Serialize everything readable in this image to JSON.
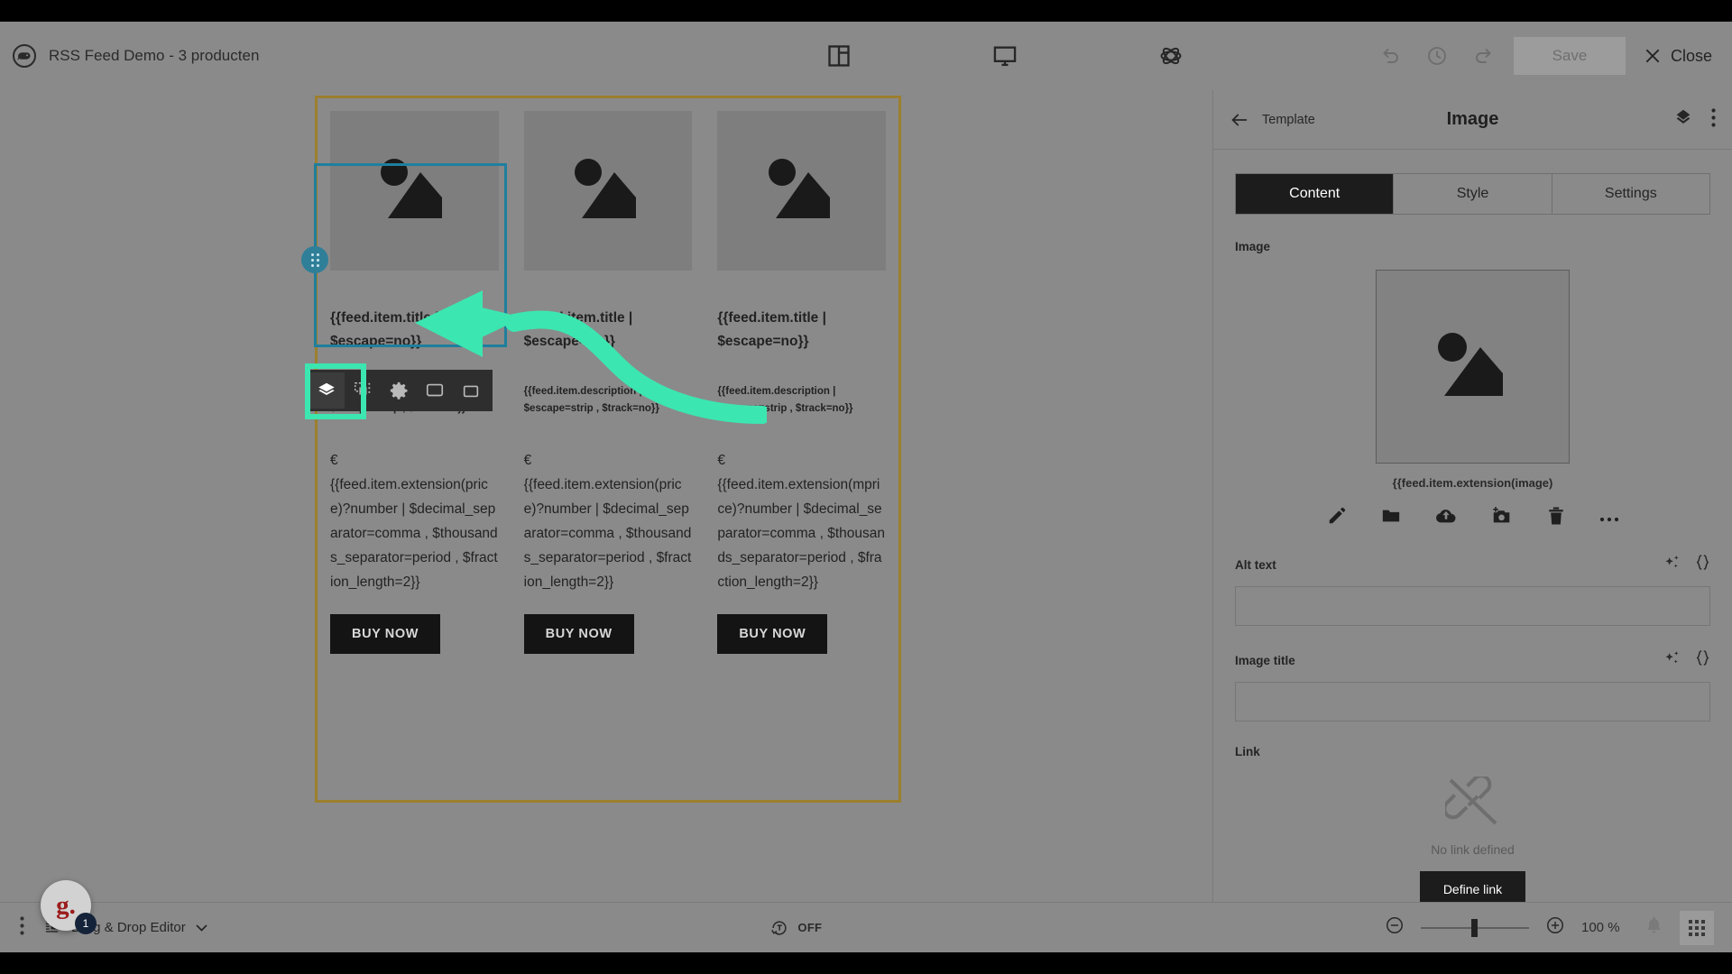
{
  "topbar": {
    "logo_icon": "bird-logo-icon",
    "document_title": "RSS Feed Demo - 3 producten",
    "center_icons": [
      {
        "name": "layout-columns-icon",
        "label": "Layout"
      },
      {
        "name": "desktop-preview-icon",
        "label": "Preview"
      },
      {
        "name": "atom-settings-icon",
        "label": "Settings"
      }
    ],
    "undo_icon": "undo-icon",
    "history_icon": "history-clock-icon",
    "redo_icon": "redo-icon",
    "save_label": "Save",
    "close_label": "Close",
    "close_icon": "close-x-icon"
  },
  "canvas": {
    "element_toolbar": [
      {
        "name": "layers-icon",
        "active": true
      },
      {
        "name": "duplicate-icon",
        "active": false
      },
      {
        "name": "gear-icon",
        "active": false
      },
      {
        "name": "swap-icon",
        "active": false
      },
      {
        "name": "delete-icon",
        "active": false
      }
    ],
    "columns": [
      {
        "title": "{{feed.item.title | $escape=no}}",
        "description": "{{feed.item.description | $escape=strip , $track=no}}",
        "currency": "€",
        "price": "{{feed.item.extension(price)?number | $decimal_separator=comma , $thousands_separator=period , $fraction_length=2}}",
        "button_label": "BUY NOW"
      },
      {
        "title": "{{feed.item.title | $escape=no}}",
        "description": "{{feed.item.description | $escape=strip , $track=no}}",
        "currency": "€",
        "price": "{{feed.item.extension(price)?number | $decimal_separator=comma , $thousands_separator=period , $fraction_length=2}}",
        "button_label": "BUY NOW"
      },
      {
        "title": "{{feed.item.title | $escape=no}}",
        "description": "{{feed.item.description | $escape=strip , $track=no}}",
        "currency": "€",
        "price": "{{feed.item.extension(mprice)?number | $decimal_separator=comma , $thousands_separator=period , $fraction_length=2}}",
        "button_label": "BUY NOW"
      }
    ]
  },
  "right_panel": {
    "back_label": "Template",
    "back_icon": "arrow-left-icon",
    "title": "Image",
    "layers_icon": "layers-diamond-icon",
    "more_icon": "more-vertical-icon",
    "tabs": [
      {
        "label": "Content",
        "active": true
      },
      {
        "label": "Style",
        "active": false
      },
      {
        "label": "Settings",
        "active": false
      }
    ],
    "image_section_label": "Image",
    "image_caption": "{{feed.item.extension(image)",
    "image_actions": [
      {
        "name": "edit-pencil-icon"
      },
      {
        "name": "folder-icon"
      },
      {
        "name": "cloud-upload-icon"
      },
      {
        "name": "camera-add-icon"
      },
      {
        "name": "trash-icon"
      },
      {
        "name": "more-horizontal-icon"
      }
    ],
    "alt_text_label": "Alt text",
    "alt_text_value": "",
    "alt_text_placeholder": "",
    "image_title_label": "Image title",
    "image_title_value": "",
    "image_title_placeholder": "",
    "ai_icon": "ai-sparkle-icon",
    "personalize_icon": "curly-braces-icon",
    "link_label": "Link",
    "link_empty_icon": "broken-link-icon",
    "link_empty_text": "No link defined",
    "define_link_label": "Define link"
  },
  "bottombar": {
    "more_icon": "more-vertical-icon",
    "editor_icon": "drag-drop-editor-icon",
    "editor_label": "Drag & Drop Editor",
    "editor_chevron": "chevron-down-icon",
    "autotranslate_icon": "auto-text-icon",
    "autotranslate_state": "OFF",
    "zoom_out_icon": "zoom-out-icon",
    "zoom_in_icon": "zoom-in-icon",
    "zoom_level": "100 %",
    "bell_icon": "bell-icon",
    "apps_icon": "apps-grid-icon"
  },
  "avatar": {
    "initial": "g.",
    "badge_count": "1"
  },
  "colors": {
    "selection": "#1f7f9c",
    "highlight": "#3ce6b0",
    "email_border": "#9c7f2e",
    "dark": "#1c1c1c"
  }
}
